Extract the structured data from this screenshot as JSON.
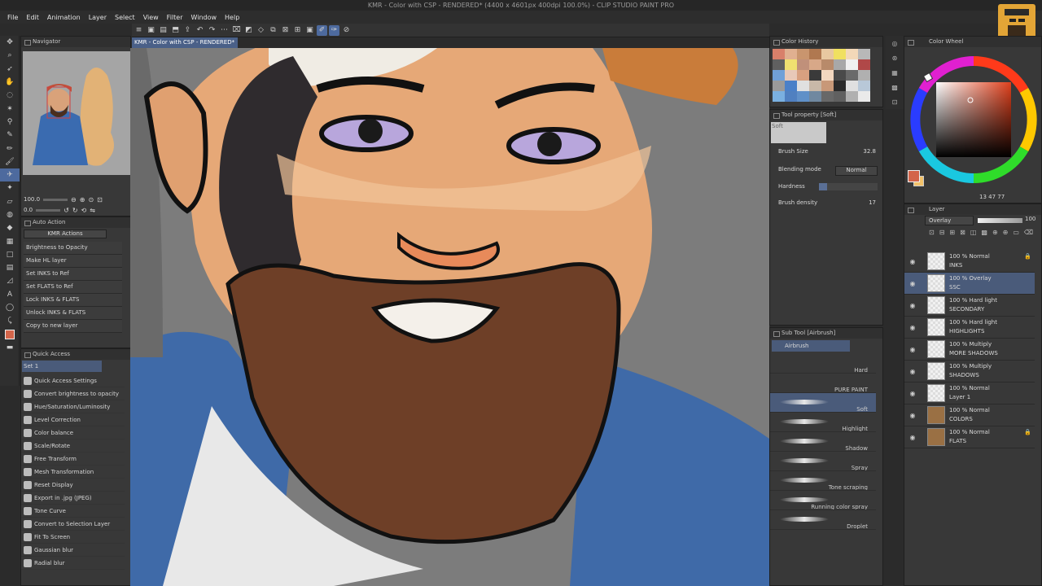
{
  "window": {
    "title": "KMR - Color with CSP - RENDERED* (4400 x 4601px 400dpi 100.0%) - CLIP STUDIO PAINT PRO"
  },
  "menu": [
    "File",
    "Edit",
    "Animation",
    "Layer",
    "Select",
    "View",
    "Filter",
    "Window",
    "Help"
  ],
  "doc_tab": "KMR - Color with CSP - RENDERED*",
  "navigator": {
    "title": "Navigator",
    "zoom": "100.0",
    "angle": "0.0"
  },
  "auto_action": {
    "title": "Auto Action",
    "set": "KMR Actions",
    "items": [
      "Brightness to Opacity",
      "Make HL layer",
      "Set INKS to Ref",
      "Set FLATS to Ref",
      "Lock INKS & FLATS",
      "Unlock INKS & FLATS",
      "Copy to new layer"
    ]
  },
  "quick_access": {
    "title": "Quick Access",
    "set": "Set 1",
    "items": [
      "Quick Access Settings",
      "Convert brightness to opacity",
      "Hue/Saturation/Luminosity",
      "Level Correction",
      "Color balance",
      "Scale/Rotate",
      "Free Transform",
      "Mesh Transformation",
      "Reset Display",
      "Export in .jpg (JPEG)",
      "Tone Curve",
      "Convert to Selection Layer",
      "Fit To Screen",
      "Gaussian blur",
      "Radial blur"
    ]
  },
  "color_history": {
    "title": "Color History",
    "colors": [
      "#d8806a",
      "#e0b090",
      "#c9956e",
      "#b07850",
      "#e8c8a0",
      "#f0e060",
      "#f3d8b8",
      "#b8b8b8",
      "#606060",
      "#f0e070",
      "#c0907a",
      "#d8a888",
      "#b88a6a",
      "#a8a8a8",
      "#f0f0f0",
      "#b04848",
      "#70a0d8",
      "#e8c8b8",
      "#d8a080",
      "#3a3a3a",
      "#f3d8c0",
      "#4a4a4a",
      "#6a6a6a",
      "#b0b0b0",
      "#9a9a9a",
      "#4a80c8",
      "#e0e0e0",
      "#c8b8a8",
      "#c89878",
      "#2a2a2a",
      "#e0e0e0",
      "#b8c8d8",
      "#7ab0e0",
      "#5080c0",
      "#6090c8",
      "#7088a0",
      "#686868",
      "#606060",
      "#b0b0b0",
      "#eaeaea"
    ]
  },
  "tool_property": {
    "title": "Tool property [Soft]",
    "brush_name": "Soft",
    "brush_size_label": "Brush Size",
    "brush_size": "32.8",
    "blending_label": "Blending mode",
    "blending": "Normal",
    "hardness_label": "Hardness",
    "density_label": "Brush density",
    "density": "17"
  },
  "sub_tool": {
    "title": "Sub Tool [Airbrush]",
    "group": "Airbrush",
    "brushes": [
      "Hard",
      "PURE PAINT",
      "Soft",
      "Highlight",
      "Shadow",
      "Spray",
      "Tone scraping",
      "Running color spray",
      "Droplet"
    ]
  },
  "color_wheel": {
    "title": "Color Wheel",
    "values": "13  47  77",
    "main_color": "#d3654a",
    "sub_color": "#f2c26a"
  },
  "layers": {
    "title": "Layer",
    "blend": "Overlay",
    "opacity": "100",
    "items": [
      {
        "mode": "100 % Normal",
        "name": "INKS",
        "locked": true,
        "img": false
      },
      {
        "mode": "100 % Overlay",
        "name": "SSC",
        "selected": true,
        "img": false
      },
      {
        "mode": "100 % Hard light",
        "name": "SECONDARY",
        "img": false
      },
      {
        "mode": "100 % Hard light",
        "name": "HIGHLIGHTS",
        "img": false
      },
      {
        "mode": "100 % Multiply",
        "name": "MORE SHADOWS",
        "img": false
      },
      {
        "mode": "100 % Multiply",
        "name": "SHADOWS",
        "img": false
      },
      {
        "mode": "100 % Normal",
        "name": "Layer 1",
        "img": false
      },
      {
        "mode": "100 % Normal",
        "name": "COLORS",
        "img": true
      },
      {
        "mode": "100 % Normal",
        "name": "FLATS",
        "locked": true,
        "img": true
      }
    ]
  }
}
